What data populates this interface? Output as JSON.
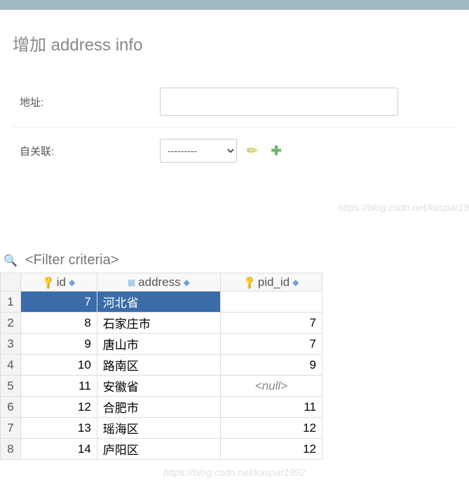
{
  "form": {
    "title": "增加 address info",
    "address_label": "地址:",
    "self_ref_label": "自关联:",
    "select_placeholder": "---------"
  },
  "watermark": "https://blog.csdn.net/kaspar19",
  "watermark_full": "https://blog.csdn.net/kaspar1992",
  "grid": {
    "filter_text": "<Filter criteria>",
    "columns": {
      "id": "id",
      "address": "address",
      "pid_id": "pid_id"
    }
  },
  "chart_data": {
    "type": "table",
    "columns": [
      "rownum",
      "id",
      "address",
      "pid_id"
    ],
    "rows": [
      {
        "rownum": 1,
        "id": 7,
        "address": "河北省",
        "pid_id": null,
        "selected": true
      },
      {
        "rownum": 2,
        "id": 8,
        "address": "石家庄市",
        "pid_id": 7
      },
      {
        "rownum": 3,
        "id": 9,
        "address": "唐山市",
        "pid_id": 7
      },
      {
        "rownum": 4,
        "id": 10,
        "address": "路南区",
        "pid_id": 9
      },
      {
        "rownum": 5,
        "id": 11,
        "address": "安徽省",
        "pid_id": null
      },
      {
        "rownum": 6,
        "id": 12,
        "address": "合肥市",
        "pid_id": 11
      },
      {
        "rownum": 7,
        "id": 13,
        "address": "瑶海区",
        "pid_id": 12
      },
      {
        "rownum": 8,
        "id": 14,
        "address": "庐阳区",
        "pid_id": 12
      }
    ]
  }
}
